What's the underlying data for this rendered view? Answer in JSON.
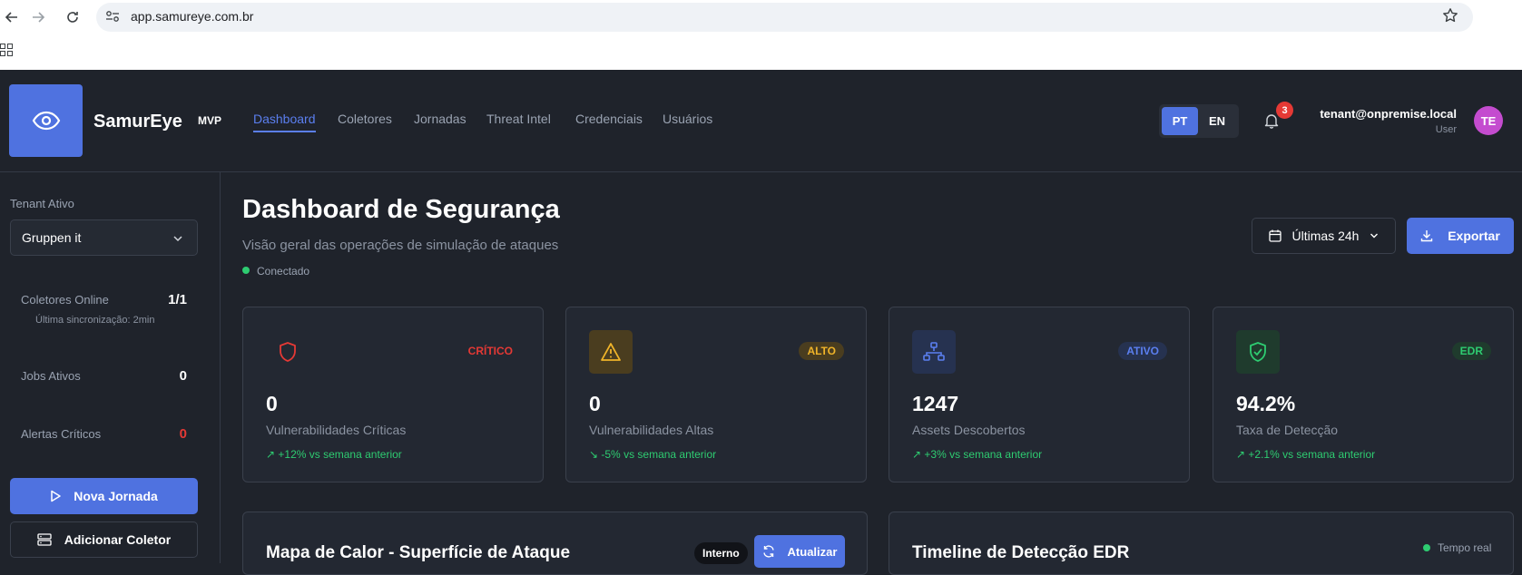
{
  "browser": {
    "url": "app.samureye.com.br"
  },
  "header": {
    "brand": "SamurEye",
    "badge": "MVP",
    "nav": [
      "Dashboard",
      "Coletores",
      "Jornadas",
      "Threat Intel",
      "Credenciais",
      "Usuários"
    ],
    "active_nav": "Dashboard",
    "lang_pt": "PT",
    "lang_en": "EN",
    "notifications": "3",
    "user_email": "tenant@onpremise.local",
    "user_role": "User",
    "avatar": "TE"
  },
  "sidebar": {
    "tenant_label": "Tenant Ativo",
    "tenant_value": "Gruppen it",
    "collectors_label": "Coletores Online",
    "collectors_value": "1/1",
    "last_sync": "Última sincronização: 2min",
    "jobs_label": "Jobs Ativos",
    "jobs_value": "0",
    "alerts_label": "Alertas Críticos",
    "alerts_value": "0",
    "new_journey": "Nova Jornada",
    "add_collector": "Adicionar Coletor"
  },
  "main": {
    "title": "Dashboard de Segurança",
    "subtitle": "Visão geral das operações de simulação de ataques",
    "status": "Conectado",
    "range": "Últimas 24h",
    "export": "Exportar",
    "cards": [
      {
        "badge": "CRÍTICO",
        "value": "0",
        "label": "Vulnerabilidades Críticas",
        "trend": "+12% vs semana anterior",
        "icon": "shield-icon"
      },
      {
        "badge": "ALTO",
        "value": "0",
        "label": "Vulnerabilidades Altas",
        "trend": "-5% vs semana anterior",
        "icon": "warning-icon"
      },
      {
        "badge": "ATIVO",
        "value": "1247",
        "label": "Assets Descobertos",
        "trend": "+3% vs semana anterior",
        "icon": "network-icon"
      },
      {
        "badge": "EDR",
        "value": "94.2%",
        "label": "Taxa de Detecção",
        "trend": "+2.1% vs semana anterior",
        "icon": "shield-check-icon"
      }
    ],
    "heatmap_panel": {
      "title": "Mapa de Calor - Superfície de Ataque",
      "tag": "Interno",
      "refresh": "Atualizar"
    },
    "timeline_panel": {
      "title": "Timeline de Detecção EDR",
      "status": "Tempo real"
    }
  },
  "colors": {
    "accent": "#4f72e0",
    "critical": "#e53935",
    "high": "#f0b429",
    "active": "#5b7ff0",
    "edr": "#2ecc71"
  }
}
